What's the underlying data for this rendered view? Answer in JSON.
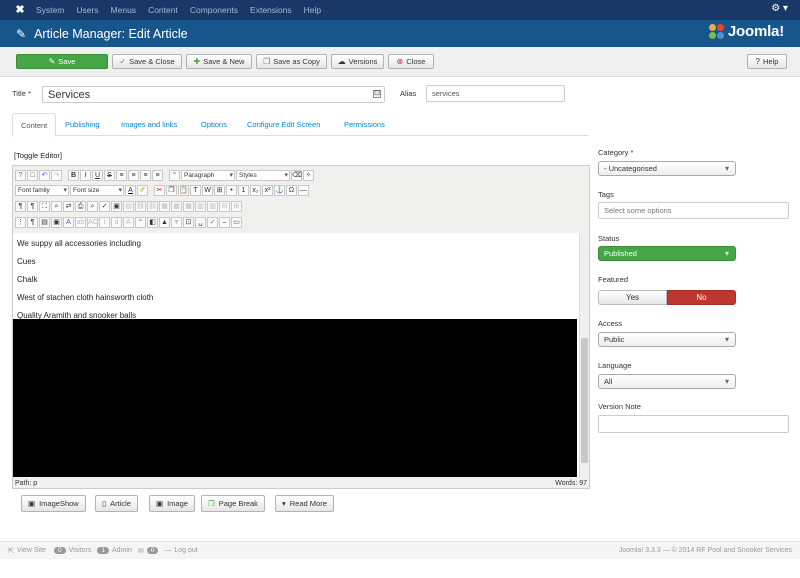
{
  "topbar": {
    "menus": [
      "System",
      "Users",
      "Menus",
      "Content",
      "Components",
      "Extensions",
      "Help"
    ]
  },
  "header": {
    "title": "Article Manager: Edit Article",
    "brand": "Joomla!"
  },
  "toolbar": {
    "save": "Save",
    "save_close": "Save & Close",
    "save_new": "Save & New",
    "save_copy": "Save as Copy",
    "versions": "Versions",
    "close": "Close",
    "help": "Help"
  },
  "form": {
    "title_label": "Title *",
    "title_value": "Services",
    "alias_label": "Alias",
    "alias_value": "services"
  },
  "tabs": [
    "Content",
    "Publishing",
    "Images and links",
    "Options",
    "Configure Edit Screen",
    "Permissions"
  ],
  "editor": {
    "toggle": "[Toggle Editor]",
    "format_select": "Paragraph",
    "styles_select": "Styles",
    "font_family": "Font family",
    "font_size": "Font size",
    "lines": [
      "We suppy all accessories including",
      "Cues",
      "Chalk",
      "West of stachen cloth hainsworth cloth",
      "Quality Aramith and snooker balls"
    ],
    "path": "Path: p",
    "words": "Words: 97"
  },
  "editor_buttons": [
    "ImageShow",
    "Article",
    "Image",
    "Page Break",
    "Read More"
  ],
  "sidebar": {
    "category_label": "Category *",
    "category_value": "- Uncategorised",
    "tags_label": "Tags",
    "tags_placeholder": "Select some options",
    "status_label": "Status",
    "status_value": "Published",
    "featured_label": "Featured",
    "featured_yes": "Yes",
    "featured_no": "No",
    "access_label": "Access",
    "access_value": "Public",
    "language_label": "Language",
    "language_value": "All",
    "version_note_label": "Version Note"
  },
  "footer": {
    "view_site": "View Site",
    "visitors_count": "0",
    "visitors": "Visitors",
    "admin_count": "1",
    "admin": "Admin",
    "mail_count": "0",
    "logout": "Log out",
    "copyright": "Joomla! 3.3.3 — © 2014 RF Pool and Snooker Services"
  },
  "colors": {
    "topbar": "#1a3867",
    "header": "#17568c",
    "save": "#46a546",
    "no": "#bd362f",
    "link": "#0088cc"
  }
}
